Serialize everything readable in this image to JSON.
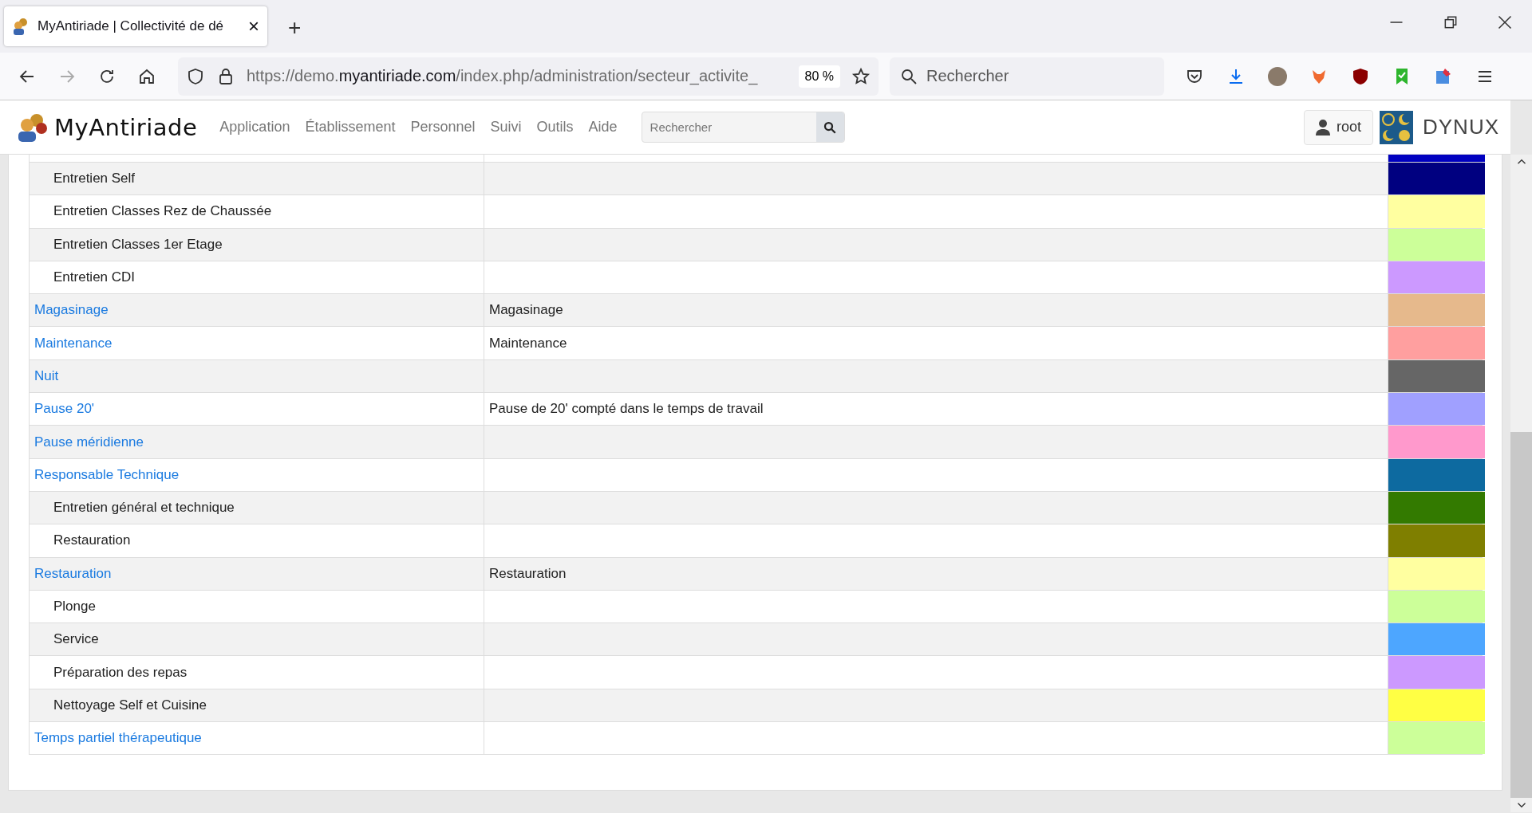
{
  "browser": {
    "tab": {
      "title": "MyAntiriade | Collectivité de dé",
      "close": "×",
      "selected": true
    },
    "new_tab": "+",
    "url": {
      "prefix": "https://demo.",
      "domain": "myantiriade.com",
      "path": "/index.php/administration/secteur_activite_"
    },
    "zoom": "80 %",
    "search": {
      "placeholder": "Rechercher"
    }
  },
  "app": {
    "logo": "MyAntiriade",
    "menu": [
      "Application",
      "Établissement",
      "Personnel",
      "Suivi",
      "Outils",
      "Aide"
    ],
    "search": {
      "placeholder": "Rechercher"
    },
    "user": "root",
    "brand": "DYNUX"
  },
  "table": {
    "clipped_row": {
      "color": "#0000c0"
    },
    "rows": [
      {
        "kind": "child",
        "label": "Entretien Self",
        "color": "#000080"
      },
      {
        "kind": "child",
        "label": "Entretien Classes Rez de Chaussée",
        "color": "#ffffa0"
      },
      {
        "kind": "child",
        "label": "Entretien Classes 1er Etage",
        "color": "#ccff99"
      },
      {
        "kind": "child",
        "label": "Entretien CDI",
        "color": "#cc99ff"
      },
      {
        "kind": "parent",
        "label": "Magasinage",
        "description": "Magasinage",
        "color": "#e6b98c"
      },
      {
        "kind": "parent",
        "label": "Maintenance",
        "description": "Maintenance",
        "color": "#ff9f9f"
      },
      {
        "kind": "parent",
        "label": "Nuit",
        "color": "#666666"
      },
      {
        "kind": "parent",
        "label": "Pause 20'",
        "description": "Pause de 20' compté dans le temps de travail",
        "color": "#a0a0ff"
      },
      {
        "kind": "parent",
        "label": "Pause méridienne",
        "color": "#ff99cc"
      },
      {
        "kind": "parent",
        "label": "Responsable Technique",
        "color": "#0d6aa0"
      },
      {
        "kind": "child",
        "label": "Entretien général et technique",
        "color": "#337a00"
      },
      {
        "kind": "child",
        "label": "Restauration",
        "color": "#7f7f00"
      },
      {
        "kind": "parent",
        "label": "Restauration",
        "description": "Restauration",
        "color": "#ffffa0"
      },
      {
        "kind": "child",
        "label": "Plonge",
        "color": "#ccff99"
      },
      {
        "kind": "child",
        "label": "Service",
        "color": "#4da6ff"
      },
      {
        "kind": "child",
        "label": "Préparation des repas",
        "color": "#cc99ff"
      },
      {
        "kind": "child",
        "label": "Nettoyage Self et Cuisine",
        "color": "#ffff44"
      },
      {
        "kind": "parent",
        "label": "Temps partiel thérapeutique",
        "color": "#ccff99"
      }
    ]
  }
}
